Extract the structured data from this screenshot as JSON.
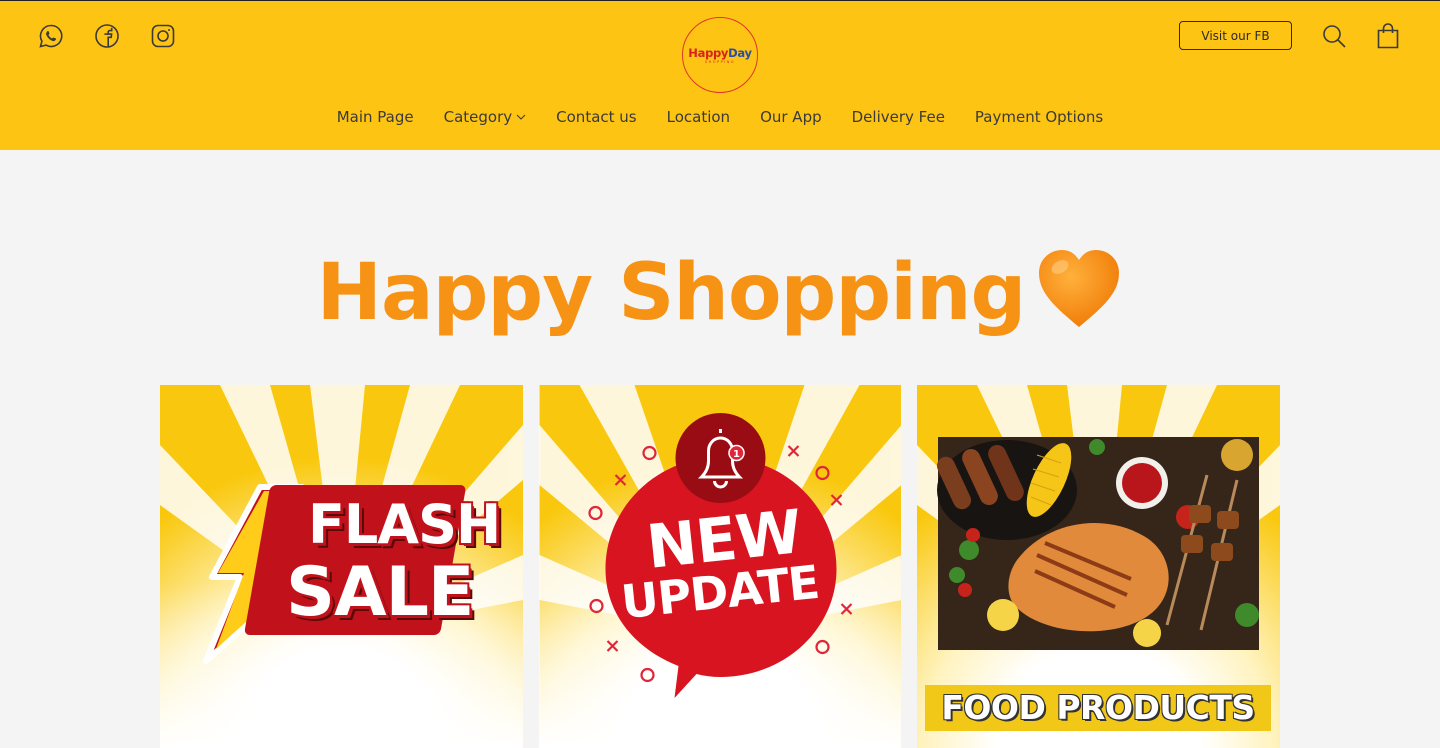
{
  "header": {
    "social": [
      {
        "icon": "whatsapp-icon"
      },
      {
        "icon": "facebook-icon"
      },
      {
        "icon": "instagram-icon"
      }
    ],
    "logo": {
      "word1": "Happy",
      "word2": "Day",
      "sub": "SHOPPING"
    },
    "fb_button": "Visit our FB",
    "search_icon": "search-icon",
    "cart_icon": "shopping-bag-icon"
  },
  "nav": {
    "items": [
      "Main Page",
      "Category",
      "Contact us",
      "Location",
      "Our App",
      "Delivery Fee",
      "Payment Options"
    ],
    "dropdown_icon": "chevron-down-icon"
  },
  "hero": {
    "title": "Happy Shopping",
    "emoji_icon": "orange-heart-icon"
  },
  "tiles": [
    {
      "line1": "FLASH",
      "line2": "SALE",
      "icon": "lightning-bolt-icon"
    },
    {
      "line1": "NEW",
      "line2": "UPDATE",
      "icon": "bell-icon",
      "badge": "1"
    },
    {
      "label": "FOOD PRODUCTS"
    }
  ],
  "colors": {
    "header_bg": "#fec414",
    "page_bg": "#f4f4f4",
    "title_orange": "#f79314",
    "brand_red": "#d7231d",
    "brand_blue": "#2b4ea8"
  }
}
